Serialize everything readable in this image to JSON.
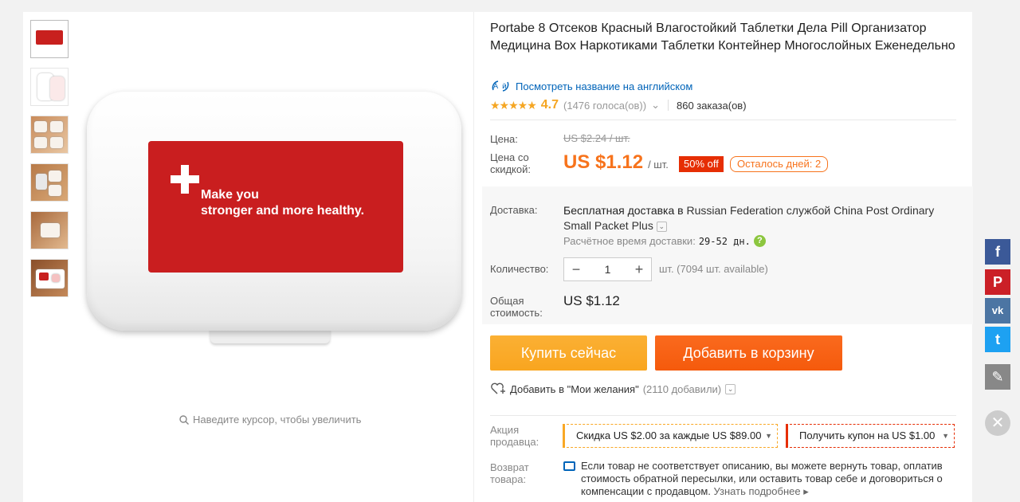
{
  "product": {
    "title": "Portabe 8 Отсеков Красный Влагостойкий Таблетки Дела Pill Организатор Медицина Вох Наркотиками Таблетки Контейнер Многослойных Еженедельно",
    "translate_link": "Посмотреть название на английском",
    "rating": "4.7",
    "stars": "★★★★★",
    "votes": "(1476 голоса(ов))",
    "orders": "860 заказа(ов)",
    "image_text_line1": "Make you",
    "image_text_line2": "stronger and more healthy.",
    "zoom_hint": "Наведите курсор, чтобы увеличить"
  },
  "price": {
    "label": "Цена:",
    "old": "US $2.24 / шт.",
    "discount_label": "Цена со скидкой:",
    "current": "US $1.12",
    "per": "/ шт.",
    "off_badge": "50% off",
    "days_left": "Осталось дней: 2"
  },
  "shipping": {
    "label": "Доставка:",
    "text_bold": "Бесплатная доставка в",
    "text_rest": " Russian Federation службой China Post Ordinary Small Packet Plus",
    "eta_label": "Расчётное время доставки:",
    "eta_value": "29-52 дн."
  },
  "quantity": {
    "label": "Количество:",
    "value": "1",
    "minus": "−",
    "plus": "+",
    "available": "шт. (7094 шт. available)"
  },
  "total": {
    "label": "Общая стоимость:",
    "value": "US $1.12"
  },
  "actions": {
    "buy_now": "Купить сейчас",
    "add_to_cart": "Добавить в корзину",
    "wishlist": "Добавить в \"Мои желания\"",
    "wishlist_count": "(2110 добавили)"
  },
  "promo": {
    "label": "Акция продавца:",
    "discount": "Скидка US $2.00 за каждые US $89.00",
    "coupon": "Получить купон на US $1.00"
  },
  "returns": {
    "label": "Возврат товара:",
    "text": "Если товар не соответствует описанию, вы можете вернуть товар, оплатив стоимость обратной пересылки, или оставить товар себе и договориться о компенсации с продавцом.",
    "more": "Узнать подробнее ▸"
  },
  "social": {
    "facebook": "f",
    "pinterest": "P",
    "vk": "vk",
    "twitter": "t",
    "edit": "✎",
    "close": "✕"
  },
  "colors": {
    "accent_orange": "#f7731c",
    "buy_button": "#f9a825",
    "cart_button": "#f55a0c",
    "link_blue": "#0064b9",
    "badge_red": "#e62e04"
  }
}
